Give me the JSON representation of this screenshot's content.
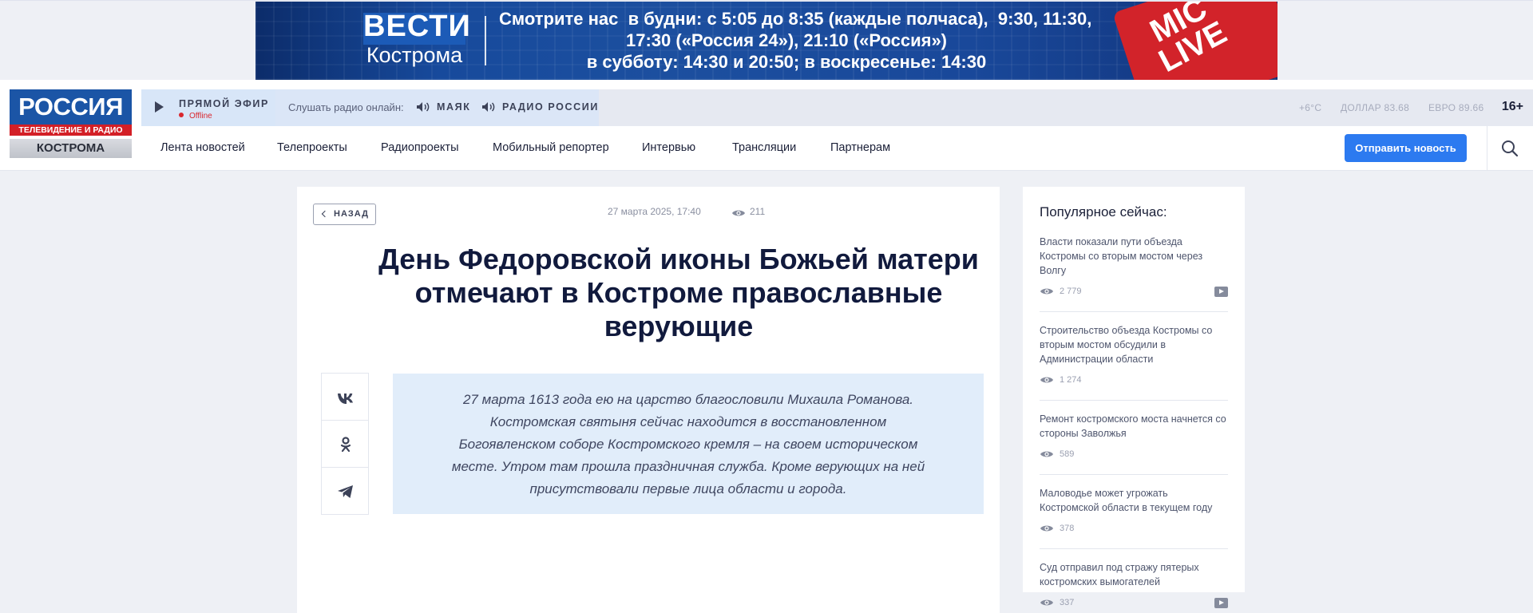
{
  "banner": {
    "brand": "ВЕСТИ",
    "city": "Кострома",
    "schedule_line1": "Смотрите нас  в будни: с 5:05 до 8:35 (каждые полчаса),  9:30, 11:30,",
    "schedule_line2": "17:30 («Россия 24»), 21:10 («Россия»)",
    "schedule_line3": "в субботу: 14:30 и 20:50; в воскресенье: 14:30",
    "live_badge": "MIC LIVE"
  },
  "logo": {
    "line1": "РОССИЯ",
    "line2": "ТЕЛЕВИДЕНИЕ И РАДИО",
    "line3": "КОСТРОМА"
  },
  "topbar": {
    "live_label": "ПРЯМОЙ ЭФИР",
    "live_status": "Offline",
    "radio_title": "Слушать радио онлайн:",
    "radio1": "МАЯК",
    "radio2": "РАДИО РОССИИ",
    "temperature": "+6°C",
    "dollar": "ДОЛЛАР 83.68",
    "euro": "ЕВРО 89.66",
    "age_rating": "16+"
  },
  "nav": {
    "items": [
      "Лента новостей",
      "Телепроекты",
      "Радиопроекты",
      "Мобильный репортер",
      "Интервью",
      "Трансляции",
      "Партнерам"
    ],
    "send_button": "Отправить новость"
  },
  "article": {
    "back_label": "НАЗАД",
    "date": "27 марта 2025, 17:40",
    "views": "211",
    "title": "День Федоровской иконы Божьей матери отмечают в Костроме православные верующие",
    "lead": "27 марта 1613 года ею на царство благословили Михаила Романова. Костромская святыня сейчас находится в восстановленном Богоявленском соборе Костромского кремля – на своем историческом месте. Утром там прошла праздничная служба. Кроме верующих на ней присутствовали первые лица области и города."
  },
  "sidebar": {
    "title": "Популярное сейчас:",
    "items": [
      {
        "text": "Власти показали пути объезда Костромы со вторым мостом через Волгу",
        "views": "2 779",
        "video": true
      },
      {
        "text": "Строительство объезда Костромы со вторым мостом обсудили в Администрации области",
        "views": "1 274",
        "video": false
      },
      {
        "text": "Ремонт костромского моста начнется со стороны Заволжья",
        "views": "589",
        "video": false
      },
      {
        "text": "Маловодье может угрожать Костромской области в текущем году",
        "views": "378",
        "video": false
      },
      {
        "text": "Суд отправил под стражу пятерых костромских вымогателей",
        "views": "337",
        "video": true
      }
    ]
  },
  "colors": {
    "accent": "#2c7af0",
    "brand_blue": "#1b55a6",
    "brand_red": "#d31f26",
    "offline_red": "#d9272e",
    "lead_bg": "#e1edfa"
  }
}
